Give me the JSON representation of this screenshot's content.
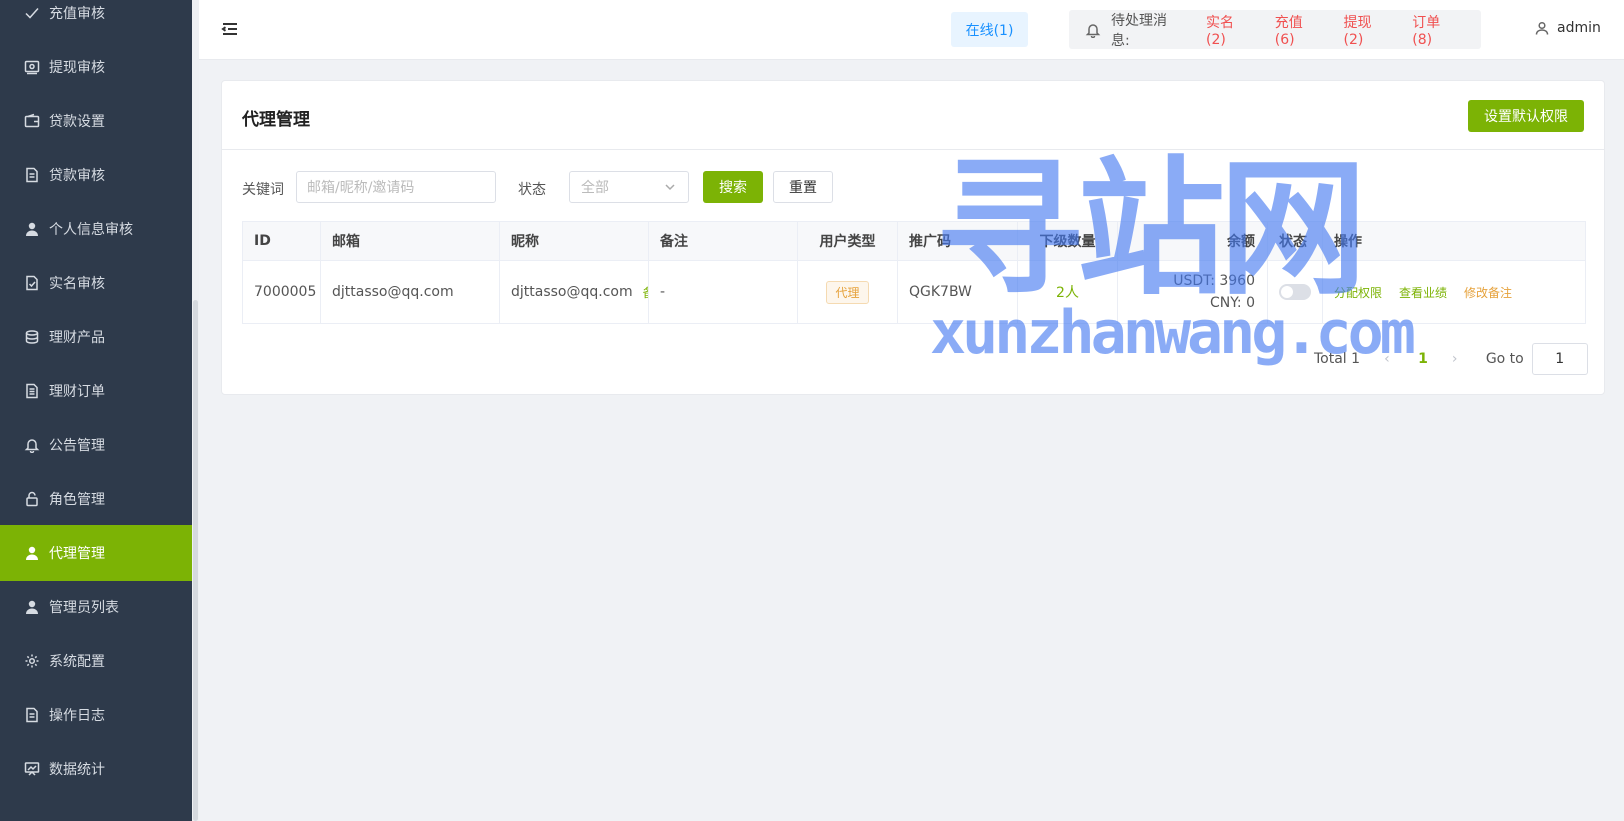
{
  "sidebar": {
    "items": [
      {
        "label": "充值审核",
        "icon": "check-icon",
        "active": false
      },
      {
        "label": "提现审核",
        "icon": "wallet-icon",
        "active": false
      },
      {
        "label": "贷款设置",
        "icon": "wallet-outline-icon",
        "active": false
      },
      {
        "label": "贷款审核",
        "icon": "document-icon",
        "active": false
      },
      {
        "label": "个人信息审核",
        "icon": "user-icon",
        "active": false
      },
      {
        "label": "实名审核",
        "icon": "document-check-icon",
        "active": false
      },
      {
        "label": "理财产品",
        "icon": "coins-icon",
        "active": false
      },
      {
        "label": "理财订单",
        "icon": "document-list-icon",
        "active": false
      },
      {
        "label": "公告管理",
        "icon": "bell-icon",
        "active": false
      },
      {
        "label": "角色管理",
        "icon": "lock-icon",
        "active": false
      },
      {
        "label": "代理管理",
        "icon": "user-icon",
        "active": true
      },
      {
        "label": "管理员列表",
        "icon": "user-icon",
        "active": false
      },
      {
        "label": "系统配置",
        "icon": "gear-icon",
        "active": false
      },
      {
        "label": "操作日志",
        "icon": "document-icon",
        "active": false
      },
      {
        "label": "数据统计",
        "icon": "chart-board-icon",
        "active": false
      }
    ]
  },
  "header": {
    "online": "在线(1)",
    "pending_label": "待处理消息:",
    "pending_links": [
      "实名(2)",
      "充值(6)",
      "提现(2)",
      "订单(8)"
    ],
    "user": "admin"
  },
  "card": {
    "title": "代理管理",
    "default_perm_button": "设置默认权限"
  },
  "filters": {
    "keyword_label": "关键词",
    "keyword_placeholder": "邮箱/昵称/邀请码",
    "status_label": "状态",
    "status_value": "全部",
    "search_button": "搜索",
    "reset_button": "重置"
  },
  "table": {
    "columns": [
      "ID",
      "邮箱",
      "昵称",
      "备注",
      "用户类型",
      "推广码",
      "下级数量",
      "余额",
      "状态",
      "操作"
    ],
    "rows": [
      {
        "id": "7000005",
        "email": "djttasso@qq.com",
        "nickname": "djttasso@qq.com",
        "nickname_tag": "备注",
        "remark": "-",
        "user_type": "代理",
        "promo_code": "QGK7BW",
        "sub_count": "2人",
        "balance_usdt": "USDT: 3960",
        "balance_cny": "CNY: 0",
        "status_on": false,
        "ops": [
          "分配权限",
          "查看业绩",
          "修改备注"
        ]
      }
    ]
  },
  "pagination": {
    "total": "Total 1",
    "current_page": "1",
    "goto_label": "Go to",
    "goto_value": "1"
  },
  "watermark": {
    "cn": "寻站网",
    "en": "xunzhanwang.com"
  },
  "colors": {
    "accent": "#7cb305",
    "sidebar_bg": "#2e3a4b",
    "danger": "#f05050",
    "warning": "#e6a23c",
    "info": "#1890ff"
  }
}
